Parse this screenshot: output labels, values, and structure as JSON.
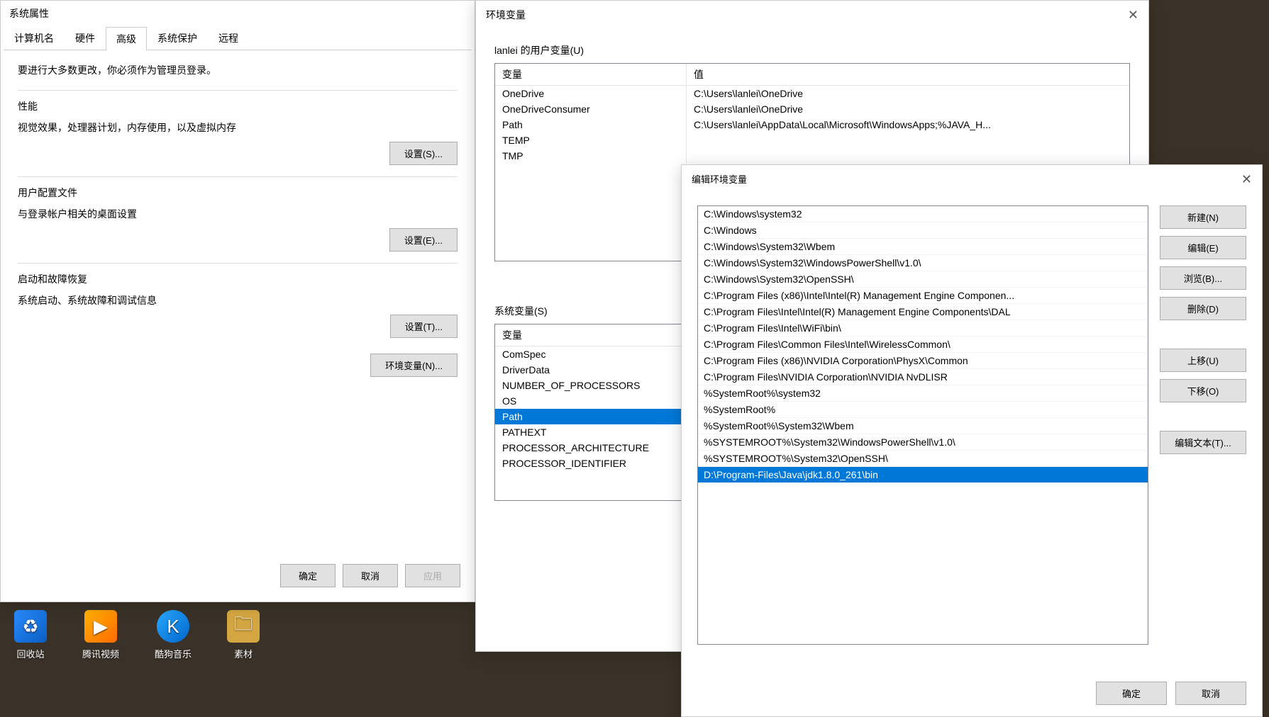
{
  "sysprops": {
    "title": "系统属性",
    "tabs": [
      "计算机名",
      "硬件",
      "高级",
      "系统保护",
      "远程"
    ],
    "active_tab": 2,
    "admin_text": "要进行大多数更改，你必须作为管理员登录。",
    "perf": {
      "title": "性能",
      "desc": "视觉效果，处理器计划，内存使用，以及虚拟内存",
      "btn": "设置(S)..."
    },
    "profile": {
      "title": "用户配置文件",
      "desc": "与登录帐户相关的桌面设置",
      "btn": "设置(E)..."
    },
    "startup": {
      "title": "启动和故障恢复",
      "desc": "系统启动、系统故障和调试信息",
      "btn": "设置(T)..."
    },
    "env_btn": "环境变量(N)...",
    "ok": "确定",
    "cancel": "取消",
    "apply": "应用"
  },
  "envvars": {
    "title": "环境变量",
    "user_label": "lanlei 的用户变量(U)",
    "sys_label": "系统变量(S)",
    "col_var": "变量",
    "col_val": "值",
    "user_rows": [
      {
        "var": "OneDrive",
        "val": "C:\\Users\\lanlei\\OneDrive"
      },
      {
        "var": "OneDriveConsumer",
        "val": "C:\\Users\\lanlei\\OneDrive"
      },
      {
        "var": "Path",
        "val": "C:\\Users\\lanlei\\AppData\\Local\\Microsoft\\WindowsApps;%JAVA_H..."
      },
      {
        "var": "TEMP",
        "val": ""
      },
      {
        "var": "TMP",
        "val": ""
      }
    ],
    "sys_rows": [
      {
        "var": "ComSpec",
        "val": ""
      },
      {
        "var": "DriverData",
        "val": ""
      },
      {
        "var": "NUMBER_OF_PROCESSORS",
        "val": ""
      },
      {
        "var": "OS",
        "val": ""
      },
      {
        "var": "Path",
        "val": ""
      },
      {
        "var": "PATHEXT",
        "val": ""
      },
      {
        "var": "PROCESSOR_ARCHITECTURE",
        "val": ""
      },
      {
        "var": "PROCESSOR_IDENTIFIER",
        "val": ""
      }
    ],
    "sys_selected": 4
  },
  "editpath": {
    "title": "编辑环境变量",
    "paths": [
      "C:\\Windows\\system32",
      "C:\\Windows",
      "C:\\Windows\\System32\\Wbem",
      "C:\\Windows\\System32\\WindowsPowerShell\\v1.0\\",
      "C:\\Windows\\System32\\OpenSSH\\",
      "C:\\Program Files (x86)\\Intel\\Intel(R) Management Engine Componen...",
      "C:\\Program Files\\Intel\\Intel(R) Management Engine Components\\DAL",
      "C:\\Program Files\\Intel\\WiFi\\bin\\",
      "C:\\Program Files\\Common Files\\Intel\\WirelessCommon\\",
      "C:\\Program Files (x86)\\NVIDIA Corporation\\PhysX\\Common",
      "C:\\Program Files\\NVIDIA Corporation\\NVIDIA NvDLISR",
      "%SystemRoot%\\system32",
      "%SystemRoot%",
      "%SystemRoot%\\System32\\Wbem",
      "%SYSTEMROOT%\\System32\\WindowsPowerShell\\v1.0\\",
      "%SYSTEMROOT%\\System32\\OpenSSH\\",
      "D:\\Program-Files\\Java\\jdk1.8.0_261\\bin"
    ],
    "selected": 16,
    "btn_new": "新建(N)",
    "btn_edit": "编辑(E)",
    "btn_browse": "浏览(B)...",
    "btn_delete": "删除(D)",
    "btn_up": "上移(U)",
    "btn_down": "下移(O)",
    "btn_edittext": "编辑文本(T)...",
    "ok": "确定",
    "cancel": "取消"
  },
  "desktop": {
    "recycle": "回收站",
    "tencent": "腾讯视频",
    "kugou": "酷狗音乐",
    "sucai": "素材"
  }
}
